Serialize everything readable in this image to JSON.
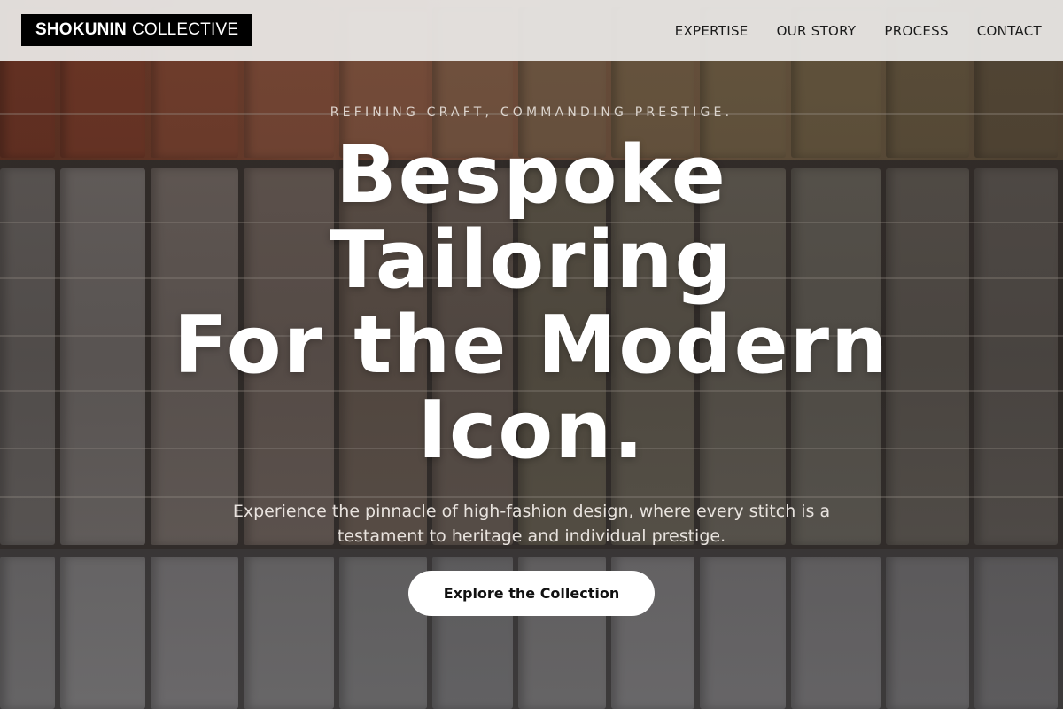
{
  "brand": {
    "name_bold": "SHOKUNIN",
    "name_light": "COLLECTIVE"
  },
  "nav": {
    "items": [
      {
        "label": "EXPERTISE"
      },
      {
        "label": "OUR STORY"
      },
      {
        "label": "PROCESS"
      },
      {
        "label": "CONTACT"
      }
    ]
  },
  "hero": {
    "tagline": "REFINING CRAFT, COMMANDING PRESTIGE.",
    "headline_lines": [
      "Bespoke",
      "Tailoring",
      "For the Modern",
      "Icon."
    ],
    "subtext": "Experience the pinnacle of high-fashion design, where every stitch is a testament to heritage and individual prestige.",
    "cta_label": "Explore the Collection"
  },
  "colors": {
    "header_bg": "#e8e6e4",
    "logo_bg": "#000000",
    "cta_bg": "#ffffff",
    "headline": "#ffffff"
  }
}
